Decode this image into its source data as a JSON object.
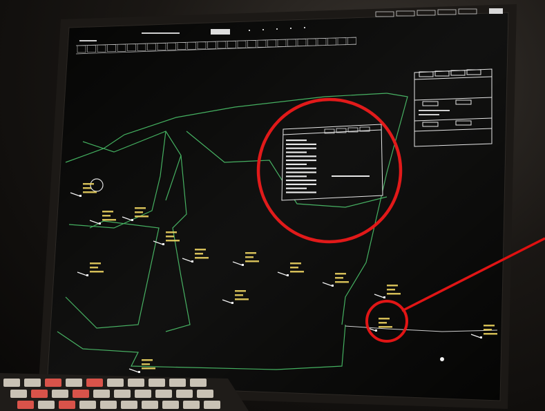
{
  "menu_bar": {
    "left_labels": [
      "",
      "",
      ""
    ],
    "center_button": "",
    "right_buttons": [
      "",
      "",
      "",
      "",
      ""
    ]
  },
  "toolbar": {
    "cells": [
      "",
      "",
      "",
      "",
      "",
      "",
      "",
      "",
      "",
      "",
      "",
      "",
      "",
      "",
      "",
      "",
      "",
      "",
      "",
      "",
      "",
      "",
      "",
      "",
      "",
      "",
      "",
      ""
    ]
  },
  "info_window": {
    "tabs": [
      "",
      "",
      "",
      ""
    ],
    "message_line_1": "",
    "message_line_2": ""
  },
  "tracks": [
    {
      "id": "t1",
      "callsign": "",
      "level": "",
      "speed": ""
    },
    {
      "id": "t2",
      "callsign": "",
      "level": "",
      "speed": ""
    },
    {
      "id": "t3",
      "callsign": "",
      "level": "",
      "speed": ""
    },
    {
      "id": "t4",
      "callsign": "",
      "level": "",
      "speed": ""
    },
    {
      "id": "t5",
      "callsign": "",
      "level": "",
      "speed": ""
    },
    {
      "id": "t6",
      "callsign": "",
      "level": "",
      "speed": ""
    },
    {
      "id": "t7",
      "callsign": "",
      "level": "",
      "speed": ""
    },
    {
      "id": "t8",
      "callsign": "",
      "level": "",
      "speed": ""
    },
    {
      "id": "t9",
      "callsign": "",
      "level": "",
      "speed": ""
    },
    {
      "id": "t10",
      "callsign": "",
      "level": "",
      "speed": ""
    },
    {
      "id": "t11",
      "callsign": "",
      "level": "",
      "speed": ""
    },
    {
      "id": "t12",
      "callsign": "",
      "level": "",
      "speed": ""
    },
    {
      "id": "t13",
      "callsign": "",
      "level": "",
      "speed": ""
    },
    {
      "id": "t14",
      "callsign": "",
      "level": "",
      "speed": ""
    }
  ],
  "colors": {
    "screen_bg": "#050504",
    "sector_line": "#3fae5c",
    "track_label": "#e9cf5a",
    "text_white": "#f2f2f2",
    "highlight_red": "#e01010"
  }
}
